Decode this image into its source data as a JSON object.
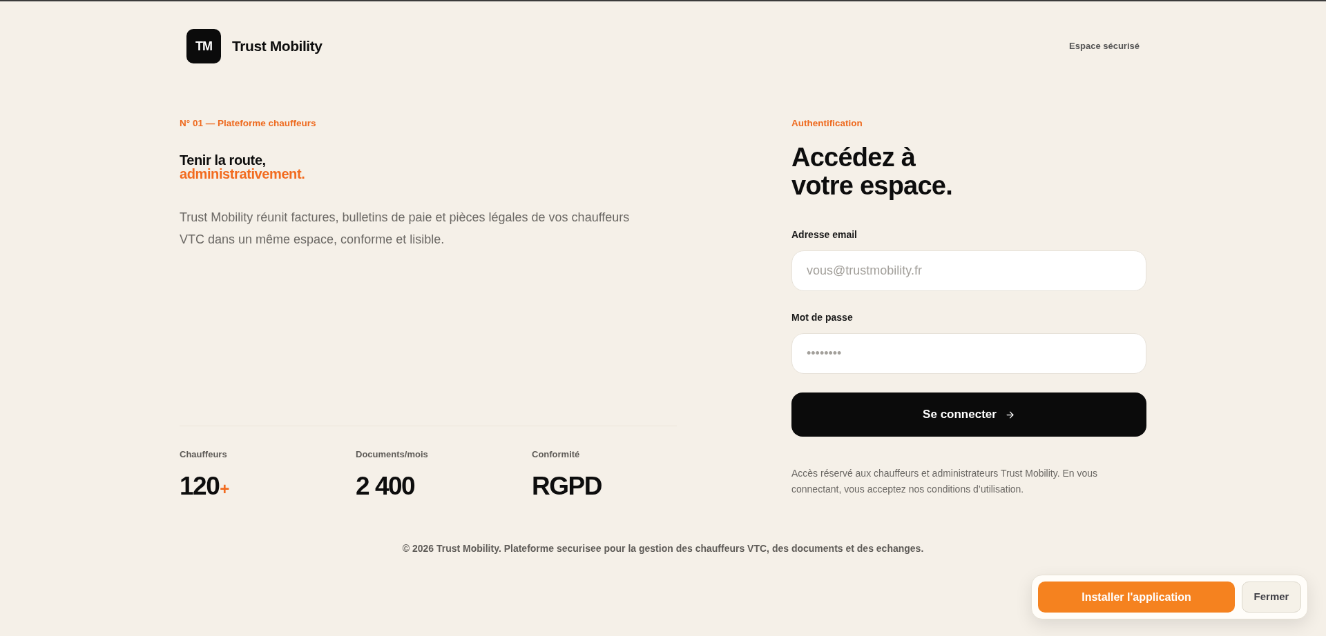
{
  "header": {
    "logo_mark": "TM",
    "brand": "Trust Mobility",
    "secure_label": "Espace sécurisé"
  },
  "hero": {
    "eyebrow": "N° 01 — Plateforme chauffeurs",
    "title": "Tenir la route,",
    "title_accent": "administrativement.",
    "description": "Trust Mobility réunit factures, bulletins de paie et pièces légales de vos chauffeurs VTC dans un même espace, conforme et lisible."
  },
  "stats": [
    {
      "label": "Chauffeurs",
      "value": "120",
      "suffix": "+"
    },
    {
      "label": "Documents/mois",
      "value": "2 400"
    },
    {
      "label": "Conformité",
      "value": "RGPD"
    }
  ],
  "login": {
    "eyebrow": "Authentification",
    "title": "Accédez à",
    "title_line_2": "votre espace.",
    "fields": [
      {
        "label": "Adresse email",
        "placeholder": "vous@trustmobility.fr"
      },
      {
        "label": "Mot de passe",
        "placeholder": "••••••••"
      }
    ],
    "submit": "Se connecter",
    "note": "Accès réservé aux chauffeurs et administrateurs Trust Mobility. En vous connectant, vous acceptez nos conditions d’utilisation."
  },
  "footer": "© 2026 Trust Mobility. Plateforme securisee pour la gestion des chauffeurs VTC, des documents et des echanges.",
  "install_banner": {
    "install": "Installer l'application",
    "close": "Fermer"
  }
}
